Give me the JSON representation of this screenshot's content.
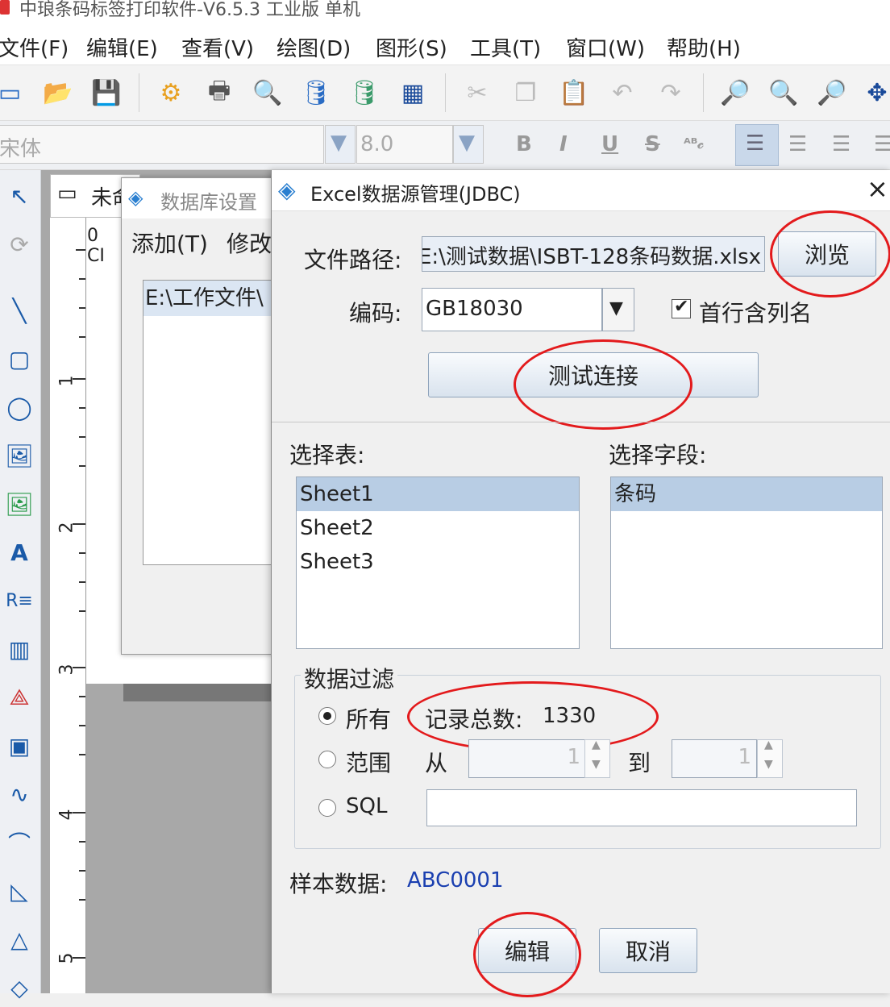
{
  "app": {
    "title": "中琅条码标签打印软件-V6.5.3 工业版 单机"
  },
  "menu": [
    "文件(F)",
    "编辑(E)",
    "查看(V)",
    "绘图(D)",
    "图形(S)",
    "工具(T)",
    "窗口(W)",
    "帮助(H)"
  ],
  "format": {
    "font": "宋体",
    "size": "8.0",
    "bold": "B",
    "italic": "I",
    "underline": "U",
    "strike": "S"
  },
  "doc": {
    "tab": "未命"
  },
  "ruler": {
    "marks": [
      "1",
      "2",
      "3",
      "4",
      "5"
    ],
    "top": "0 CI"
  },
  "dbsettings": {
    "title": "数据库设置",
    "add": "添加(T)",
    "modify": "修改",
    "item": "E:\\工作文件\\"
  },
  "dialog": {
    "title": "Excel数据源管理(JDBC)",
    "close": "×",
    "path_label": "文件路径:",
    "path_value": "E:\\测试数据\\ISBT-128条码数据.xlsx",
    "browse": "浏览",
    "encoding_label": "编码:",
    "encoding_value": "GB18030",
    "header_checkbox": "首行含列名",
    "test_connection": "测试连接",
    "table_label": "选择表:",
    "tables": [
      "Sheet1",
      "Sheet2",
      "Sheet3"
    ],
    "field_label": "选择字段:",
    "fields": [
      "条码"
    ],
    "filter_group": "数据过滤",
    "radio_all": "所有",
    "record_count_label": "记录总数:",
    "record_count": "1330",
    "radio_range": "范围",
    "from": "从",
    "from_value": "1",
    "to": "到",
    "to_value": "1",
    "radio_sql": "SQL",
    "sample_label": "样本数据:",
    "sample_value": "ABC0001",
    "edit": "编辑",
    "cancel": "取消"
  },
  "colors": {
    "highlight_circle": "#e31a1c",
    "selection": "#b8cde4",
    "sample_text": "#1a3fb0"
  }
}
